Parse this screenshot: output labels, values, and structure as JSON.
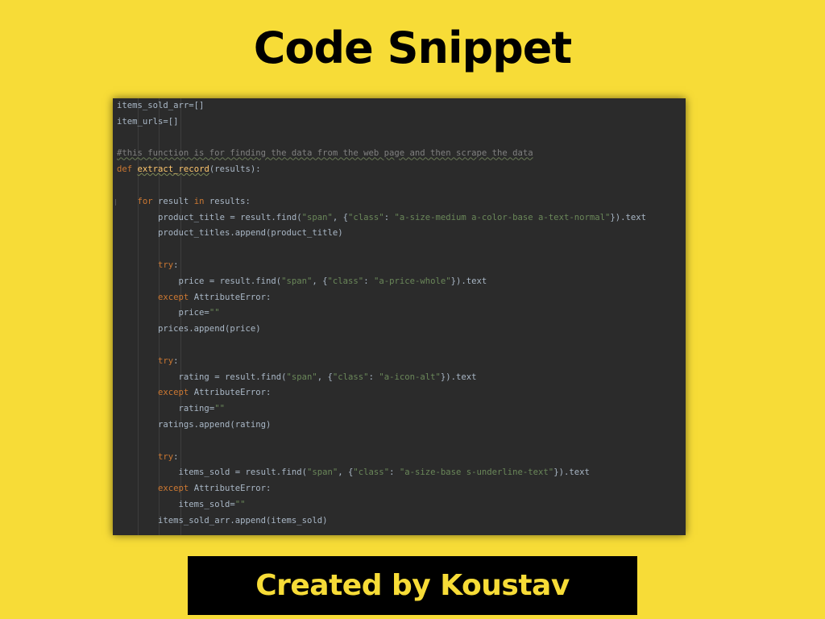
{
  "title": "Code Snippet",
  "footer": "Created by Koustav",
  "colors": {
    "background": "#f7dc37",
    "panel": "#2b2b2b",
    "keyword": "#cc7832",
    "string": "#6a8759",
    "comment": "#808080",
    "function": "#ffc66d",
    "text": "#a9b7c6"
  },
  "code": {
    "l1": "items_sold_arr=[]",
    "l2": "item_urls=[]",
    "l3": "",
    "l4_comment": "#this function is for finding the data from the web page and then scrape the data",
    "l5_def": "def",
    "l5_fn": "extract_record",
    "l5_args": "(results):",
    "l6": "",
    "l7_for": "for",
    "l7_mid": " result ",
    "l7_in": "in",
    "l7_end": " results:",
    "l8_a": "product_title = result.find(",
    "l8_s1": "\"span\"",
    "l8_b": ", {",
    "l8_s2": "\"class\"",
    "l8_c": ": ",
    "l8_s3": "\"a-size-medium a-color-base a-text-normal\"",
    "l8_d": "}).text",
    "l9": "product_titles.append(product_title)",
    "l10": "",
    "l11_try": "try",
    "l11_colon": ":",
    "l12_a": "price = result.find(",
    "l12_s1": "\"span\"",
    "l12_b": ", {",
    "l12_s2": "\"class\"",
    "l12_c": ": ",
    "l12_s3": "\"a-price-whole\"",
    "l12_d": "}).text",
    "l13_except": "except",
    "l13_err": " AttributeError:",
    "l14_a": "price=",
    "l14_s": "\"\"",
    "l15": "prices.append(price)",
    "l16": "",
    "l17_try": "try",
    "l17_colon": ":",
    "l18_a": "rating = result.find(",
    "l18_s1": "\"span\"",
    "l18_b": ", {",
    "l18_s2": "\"class\"",
    "l18_c": ": ",
    "l18_s3": "\"a-icon-alt\"",
    "l18_d": "}).text",
    "l19_except": "except",
    "l19_err": " AttributeError:",
    "l20_a": "rating=",
    "l20_s": "\"\"",
    "l21": "ratings.append(rating)",
    "l22": "",
    "l23_try": "try",
    "l23_colon": ":",
    "l24_a": "items_sold = result.find(",
    "l24_s1": "\"span\"",
    "l24_b": ", {",
    "l24_s2": "\"class\"",
    "l24_c": ": ",
    "l24_s3": "\"a-size-base s-underline-text\"",
    "l24_d": "}).text",
    "l25_except": "except",
    "l25_err": " AttributeError:",
    "l26_a": "items_sold=",
    "l26_s": "\"\"",
    "l27": "items_sold_arr.append(items_sold)"
  }
}
